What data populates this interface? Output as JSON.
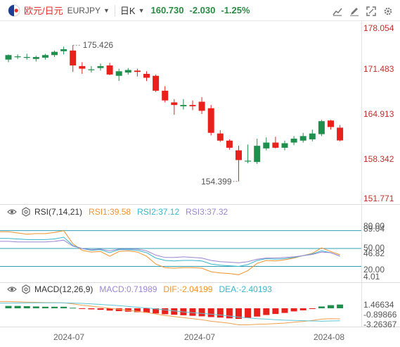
{
  "header": {
    "pair_cn": "欧元/日元",
    "pair_code": "EURJPY",
    "period": "日K",
    "price": "160.730",
    "change": "-2.030",
    "change_pct": "-1.25%"
  },
  "colors": {
    "up": "#1f8f4e",
    "down": "#e8211d",
    "rsi1": "#f0932b",
    "rsi2": "#39b6c9",
    "rsi3": "#9c86d1",
    "ref_line": "#2f9fb5",
    "dif": "#f0a050",
    "dea": "#5fc6d6"
  },
  "icons": {
    "flag": "eu-jp-flag-icon",
    "caret": "caret-down-icon",
    "tools": [
      "indicator-icon",
      "drawing-icon",
      "fullscreen-icon",
      "settings-icon"
    ]
  },
  "chart_data": [
    {
      "type": "candlestick",
      "title": "EURJPY",
      "ylim": [
        151.771,
        178.054
      ],
      "y_ticks": [
        "178.054",
        "171.483",
        "164.913",
        "158.342",
        "151.771"
      ],
      "x_ticks": [
        "2024-07",
        "2024-07",
        "2024-08"
      ],
      "annotations": {
        "high": "175.426",
        "low": "154.399"
      },
      "candles": [
        {
          "o": 173.2,
          "h": 174.0,
          "l": 172.8,
          "c": 173.9
        },
        {
          "o": 173.6,
          "h": 174.0,
          "l": 173.3,
          "c": 173.7
        },
        {
          "o": 173.6,
          "h": 174.1,
          "l": 173.2,
          "c": 173.6
        },
        {
          "o": 173.3,
          "h": 173.8,
          "l": 172.9,
          "c": 173.6
        },
        {
          "o": 173.5,
          "h": 174.1,
          "l": 173.2,
          "c": 173.9
        },
        {
          "o": 173.9,
          "h": 174.6,
          "l": 173.6,
          "c": 174.4
        },
        {
          "o": 174.5,
          "h": 175.2,
          "l": 174.0,
          "c": 174.8
        },
        {
          "o": 174.6,
          "h": 175.426,
          "l": 171.3,
          "c": 172.3
        },
        {
          "o": 172.2,
          "h": 172.8,
          "l": 171.0,
          "c": 171.8
        },
        {
          "o": 171.7,
          "h": 172.2,
          "l": 171.2,
          "c": 171.7
        },
        {
          "o": 171.9,
          "h": 172.6,
          "l": 171.5,
          "c": 172.2
        },
        {
          "o": 172.3,
          "h": 172.7,
          "l": 170.8,
          "c": 170.9
        },
        {
          "o": 170.7,
          "h": 171.8,
          "l": 169.9,
          "c": 171.4
        },
        {
          "o": 171.2,
          "h": 171.9,
          "l": 170.9,
          "c": 171.6
        },
        {
          "o": 171.5,
          "h": 171.8,
          "l": 170.6,
          "c": 171.3
        },
        {
          "o": 171.0,
          "h": 171.4,
          "l": 169.9,
          "c": 170.4
        },
        {
          "o": 170.7,
          "h": 170.9,
          "l": 168.2,
          "c": 168.4
        },
        {
          "o": 168.4,
          "h": 169.1,
          "l": 166.6,
          "c": 166.9
        },
        {
          "o": 166.6,
          "h": 167.1,
          "l": 164.7,
          "c": 166.2
        },
        {
          "o": 166.0,
          "h": 167.1,
          "l": 165.5,
          "c": 166.2
        },
        {
          "o": 166.2,
          "h": 166.9,
          "l": 165.4,
          "c": 166.0
        },
        {
          "o": 166.7,
          "h": 167.4,
          "l": 164.8,
          "c": 165.3
        },
        {
          "o": 165.7,
          "h": 166.2,
          "l": 161.5,
          "c": 161.9
        },
        {
          "o": 161.8,
          "h": 162.3,
          "l": 160.5,
          "c": 160.7
        },
        {
          "o": 160.7,
          "h": 160.9,
          "l": 159.3,
          "c": 159.6
        },
        {
          "o": 159.2,
          "h": 159.9,
          "l": 154.399,
          "c": 157.7
        },
        {
          "o": 157.6,
          "h": 160.1,
          "l": 157.2,
          "c": 157.6
        },
        {
          "o": 157.4,
          "h": 161.0,
          "l": 157.1,
          "c": 159.9
        },
        {
          "o": 159.5,
          "h": 161.2,
          "l": 159.2,
          "c": 160.4
        },
        {
          "o": 160.4,
          "h": 161.3,
          "l": 159.5,
          "c": 159.6
        },
        {
          "o": 159.6,
          "h": 160.7,
          "l": 159.2,
          "c": 160.3
        },
        {
          "o": 160.4,
          "h": 161.4,
          "l": 160.0,
          "c": 161.0
        },
        {
          "o": 160.7,
          "h": 161.9,
          "l": 160.4,
          "c": 161.4
        },
        {
          "o": 160.9,
          "h": 162.4,
          "l": 160.6,
          "c": 161.8
        },
        {
          "o": 161.7,
          "h": 163.9,
          "l": 161.4,
          "c": 163.7
        },
        {
          "o": 163.8,
          "h": 163.9,
          "l": 162.4,
          "c": 162.8
        },
        {
          "o": 162.7,
          "h": 163.1,
          "l": 160.6,
          "c": 160.73
        }
      ]
    },
    {
      "type": "line",
      "title": "RSI(7,14,21)",
      "ylim": [
        4.01,
        89.04
      ],
      "y_ticks": [
        "80.00",
        "89.04",
        "50.00",
        "46.82",
        "20.00",
        "4.01"
      ],
      "ref_lines": [
        80,
        50,
        20
      ],
      "series": [
        {
          "name": "RSI1",
          "label": "RSI1:39.58",
          "values": [
            78,
            76,
            74,
            75,
            75,
            77,
            80,
            58,
            47,
            44,
            45,
            37,
            45,
            46,
            44,
            37,
            24,
            18,
            17,
            18,
            18,
            17,
            11,
            9,
            8,
            6,
            13,
            25,
            30,
            29,
            31,
            34,
            38,
            42,
            51,
            45,
            39.58
          ]
        },
        {
          "name": "RSI2",
          "label": "RSI2:37.12",
          "values": [
            67,
            66,
            65,
            65,
            65,
            66,
            69,
            55,
            50,
            47,
            48,
            43,
            48,
            48,
            47,
            43,
            34,
            30,
            29,
            30,
            30,
            29,
            24,
            22,
            21,
            20,
            23,
            30,
            33,
            32,
            33,
            35,
            38,
            41,
            46,
            43,
            37.12
          ]
        },
        {
          "name": "RSI3",
          "label": "RSI3:37.32",
          "values": [
            62,
            61,
            61,
            61,
            61,
            62,
            64,
            54,
            50,
            48,
            49,
            46,
            49,
            49,
            49,
            46,
            39,
            35,
            35,
            36,
            35,
            34,
            30,
            28,
            27,
            26,
            28,
            32,
            34,
            34,
            35,
            36,
            38,
            40,
            44,
            43,
            37.32
          ]
        }
      ]
    },
    {
      "type": "bar",
      "title": "MACD(12,26,9)",
      "ylim": [
        -3.4,
        1.9
      ],
      "y_ticks": [
        "1.46634",
        "-0.89866",
        "-3.26367"
      ],
      "series": [
        {
          "name": "MACD",
          "label": "MACD:0.71989",
          "values": [
            0.45,
            0.45,
            0.4,
            0.35,
            0.3,
            0.3,
            0.3,
            0.1,
            -0.05,
            -0.2,
            -0.3,
            -0.45,
            -0.55,
            -0.65,
            -0.75,
            -0.85,
            -1.0,
            -1.15,
            -1.25,
            -1.35,
            -1.45,
            -1.55,
            -1.7,
            -1.8,
            -1.95,
            -2.05,
            -1.9,
            -1.6,
            -1.3,
            -1.1,
            -0.9,
            -0.6,
            -0.4,
            -0.05,
            0.35,
            0.6,
            0.71989
          ]
        },
        {
          "name": "DIF",
          "label": "DIF:-2.04199",
          "values": [
            1.3,
            1.25,
            1.2,
            1.15,
            1.1,
            1.1,
            1.05,
            0.85,
            0.6,
            0.4,
            0.2,
            0.0,
            -0.2,
            -0.4,
            -0.6,
            -0.8,
            -1.1,
            -1.4,
            -1.6,
            -1.8,
            -2.0,
            -2.2,
            -2.5,
            -2.7,
            -2.9,
            -3.2,
            -3.2,
            -3.1,
            -3.05,
            -2.95,
            -2.85,
            -2.7,
            -2.55,
            -2.35,
            -2.1,
            -2.0,
            -2.04199
          ]
        },
        {
          "name": "DEA",
          "label": "DEA:-2.40193",
          "values": [
            1.0,
            1.02,
            1.03,
            1.04,
            1.05,
            1.05,
            1.05,
            1.0,
            0.95,
            0.85,
            0.75,
            0.62,
            0.5,
            0.35,
            0.2,
            0.05,
            -0.1,
            -0.3,
            -0.5,
            -0.7,
            -0.85,
            -1.0,
            -1.15,
            -1.3,
            -1.5,
            -1.7,
            -1.85,
            -2.0,
            -2.1,
            -2.2,
            -2.3,
            -2.35,
            -2.4,
            -2.45,
            -2.5,
            -2.45,
            -2.40193
          ]
        }
      ]
    }
  ]
}
